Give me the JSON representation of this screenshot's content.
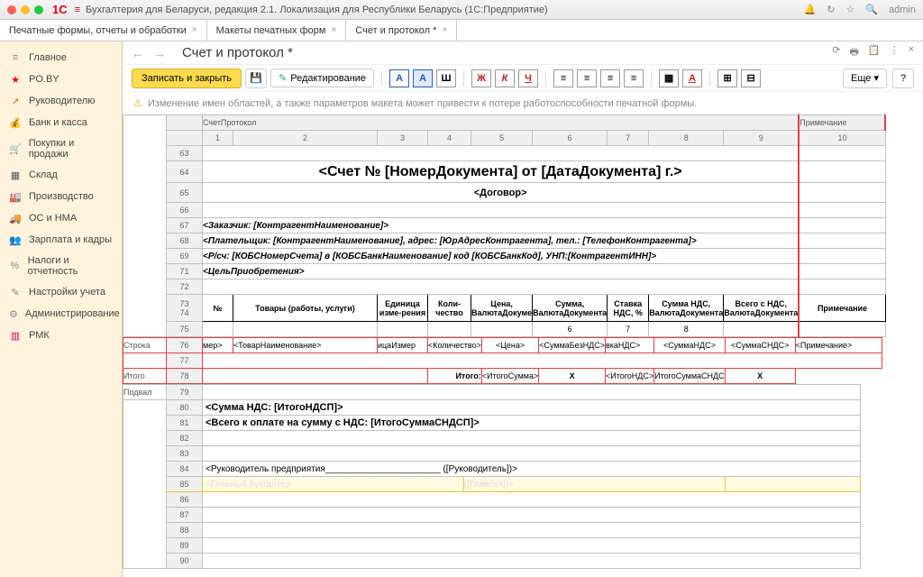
{
  "app": {
    "title": "Бухгалтерия для Беларуси, редакция 2.1. Локализация для Республики Беларусь   (1С:Предприятие)",
    "logo": "1C",
    "user": "admin"
  },
  "tabs": [
    {
      "label": "Печатные формы, отчеты и обработки"
    },
    {
      "label": "Макеты печатных форм"
    },
    {
      "label": "Счет и протокол *"
    }
  ],
  "sidebar": [
    {
      "icon": "≡",
      "label": "Главное",
      "color": "#888"
    },
    {
      "icon": "★",
      "label": "PO.BY",
      "color": "#e30613"
    },
    {
      "icon": "↗",
      "label": "Руководителю",
      "color": "#e07000"
    },
    {
      "icon": "🏦",
      "label": "Банк и касса",
      "color": "#2a8"
    },
    {
      "icon": "🛒",
      "label": "Покупки и продажи",
      "color": "#556"
    },
    {
      "icon": "▦",
      "label": "Склад",
      "color": "#556"
    },
    {
      "icon": "🏭",
      "label": "Производство",
      "color": "#556"
    },
    {
      "icon": "🚚",
      "label": "ОС и НМА",
      "color": "#556"
    },
    {
      "icon": "👥",
      "label": "Зарплата и кадры",
      "color": "#2a8"
    },
    {
      "icon": "%",
      "label": "Налоги и отчетность",
      "color": "#889"
    },
    {
      "icon": "✎",
      "label": "Настройки учета",
      "color": "#889"
    },
    {
      "icon": "⚙",
      "label": "Администрирование",
      "color": "#889"
    },
    {
      "icon": "▥",
      "label": "РМК",
      "color": "#c06"
    }
  ],
  "page": {
    "title": "Счет и протокол *",
    "save": "Записать и закрыть",
    "edit": "Редактирование",
    "more": "Еще",
    "warn": "Изменение имен областей, а также параметров макета может привести к потере работоспособности печатной формы."
  },
  "sheet": {
    "section1": "СчетПротокол",
    "section2": "Примечание",
    "cols": [
      "1",
      "2",
      "3",
      "4",
      "5",
      "6",
      "7",
      "8",
      "9",
      "10"
    ],
    "leftlabels": [
      "Строка",
      "Итого",
      "Подвал"
    ],
    "doc_title": "<Счет № [НомерДокумента] от [ДатаДокумента] г.>",
    "contract": "<Договор>",
    "customer": "<Заказчик: [КонтрагентНаименование]>",
    "payer": "<Плательщик: [КонтрагентНаименование], адрес: [ЮрАдресКонтрагента], тел.: [ТелефонКонтрагента]>",
    "account": "<Р/сч: [КОБСНомерСчета] в [КОБСБанкНаименование] код [КОБСБанкКод], УНП:[КонтрагентИНН]>",
    "purpose": "<ЦельПриобретения>",
    "headers": [
      "№",
      "Товары (работы, услуги)",
      "Единица изме-рения",
      "Коли-чество",
      "Цена, ВалютаДокуме",
      "Сумма, ВалютаДокумента",
      "Ставка НДС, %",
      "Сумма НДС, ВалютаДокумента",
      "Всего с НДС, ВалютаДокумента",
      "Примечание"
    ],
    "subnums": [
      "",
      "",
      "",
      "",
      "",
      "6",
      "7",
      "8",
      ""
    ],
    "row_tpl": [
      "мер>",
      "<ТоварНаименование>",
      "ицаИзмер",
      "<Количество>",
      "<Цена>",
      "<СуммаБезНДС>",
      "вкаНДС>",
      "<СуммаНДС>",
      "<СуммаСНДС>",
      "<Примечание>"
    ],
    "totals_label": "Итого:",
    "totals": [
      "<ИтогоСумма>",
      "X",
      "<ИтогоНДС>",
      "ИтогоСуммаСНДС",
      "X"
    ],
    "vat": "<Сумма НДС: [ИтогоНДСП]>",
    "grand": "<Всего к оплате  на сумму с НДС: [ИтогоСуммаСНДСП]>",
    "sign1": "<Руководитель предприятия_______________________ ([Руководитель])>",
    "sign2a": "<Главный бухгалтер",
    "sign2b": "([Главбух])>"
  }
}
